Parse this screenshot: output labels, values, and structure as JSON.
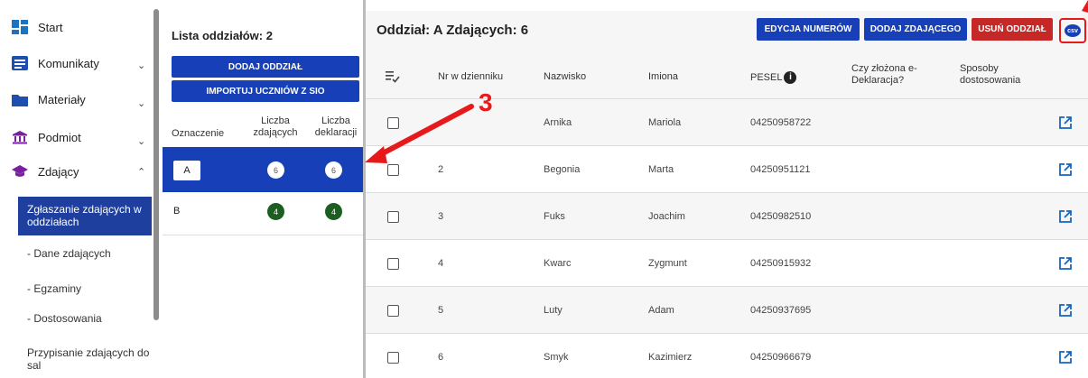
{
  "sidebar": {
    "items": [
      {
        "label": "Start",
        "icon": "dashboard-icon"
      },
      {
        "label": "Komunikaty",
        "icon": "message-icon"
      },
      {
        "label": "Materiały",
        "icon": "folder-icon"
      },
      {
        "label": "Podmiot",
        "icon": "institution-icon"
      },
      {
        "label": "Zdający",
        "icon": "graduation-cap-icon"
      }
    ],
    "subitems": [
      {
        "label": "Zgłaszanie zdających w oddziałach",
        "active": true
      },
      {
        "label": "Dane zdających"
      },
      {
        "label": "Egzaminy"
      },
      {
        "label": "Dostosowania"
      },
      {
        "label": "Przypisanie zdających do sal"
      }
    ]
  },
  "groups": {
    "title": "Lista oddziałów: 2",
    "add_button": "DODAJ ODDZIAŁ",
    "import_button": "IMPORTUJ UCZNIÓW Z SIO",
    "col_name": "Oznaczenie",
    "col_students": "Liczba zdających",
    "col_declarations": "Liczba deklaracji",
    "rows": [
      {
        "name": "A",
        "students": "6",
        "declarations": "6",
        "selected": true
      },
      {
        "name": "B",
        "students": "4",
        "declarations": "4",
        "selected": false
      }
    ]
  },
  "main": {
    "title": "Oddział: A Zdających: 6",
    "buttons": {
      "edit_numbers": "EDYCJA NUMERÓW",
      "add_student": "DODAJ ZDAJĄCEGO",
      "delete_group": "USUŃ ODDZIAŁ",
      "csv": "csv"
    },
    "columns": {
      "number": "Nr w dzienniku",
      "surname": "Nazwisko",
      "names": "Imiona",
      "pesel": "PESEL",
      "declaration": "Czy złożona e-Deklaracja?",
      "adaptations": "Sposoby dostosowania"
    },
    "rows": [
      {
        "number": "",
        "surname": "Arnika",
        "name": "Mariola",
        "pesel": "04250958722"
      },
      {
        "number": "2",
        "surname": "Begonia",
        "name": "Marta",
        "pesel": "04250951121"
      },
      {
        "number": "3",
        "surname": "Fuks",
        "name": "Joachim",
        "pesel": "04250982510"
      },
      {
        "number": "4",
        "surname": "Kwarc",
        "name": "Zygmunt",
        "pesel": "04250915932"
      },
      {
        "number": "5",
        "surname": "Luty",
        "name": "Adam",
        "pesel": "04250937695"
      },
      {
        "number": "6",
        "surname": "Smyk",
        "name": "Kazimierz",
        "pesel": "04250966679"
      }
    ]
  },
  "annotation": {
    "label": "3"
  },
  "colors": {
    "primary": "#1740b8",
    "danger": "#c62828",
    "badge_green": "#1b5e20",
    "annotation": "#e8191b"
  }
}
